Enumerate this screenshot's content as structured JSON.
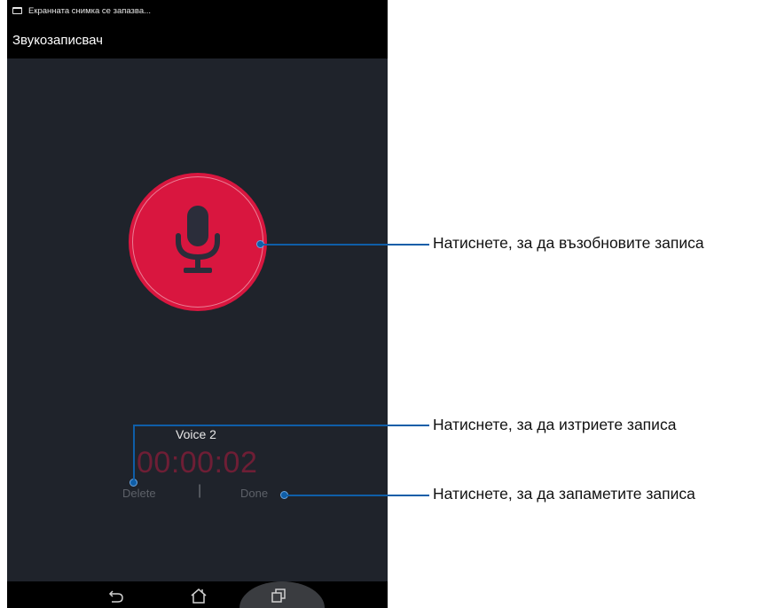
{
  "status_bar": {
    "notification_icon": "screenshot-notification-icon",
    "notification_text": "Екранната снимка се запазва..."
  },
  "app": {
    "title": "Звукозаписвач"
  },
  "recorder": {
    "record_button_icon": "microphone-icon",
    "record_color": "#d9163f",
    "file_name": "Voice 2",
    "elapsed_time": "00:00:02",
    "delete_label": "Delete",
    "separator": "|",
    "done_label": "Done"
  },
  "nav_bar": {
    "back_icon": "back-icon",
    "home_icon": "home-icon",
    "recents_icon": "recent-apps-icon"
  },
  "callouts": {
    "resume": "Натиснете, за да възобновите записа",
    "delete": "Натиснете, за да изтриете записа",
    "save": "Натиснете, за да запаметите записа",
    "color": "#0f5ea8"
  }
}
